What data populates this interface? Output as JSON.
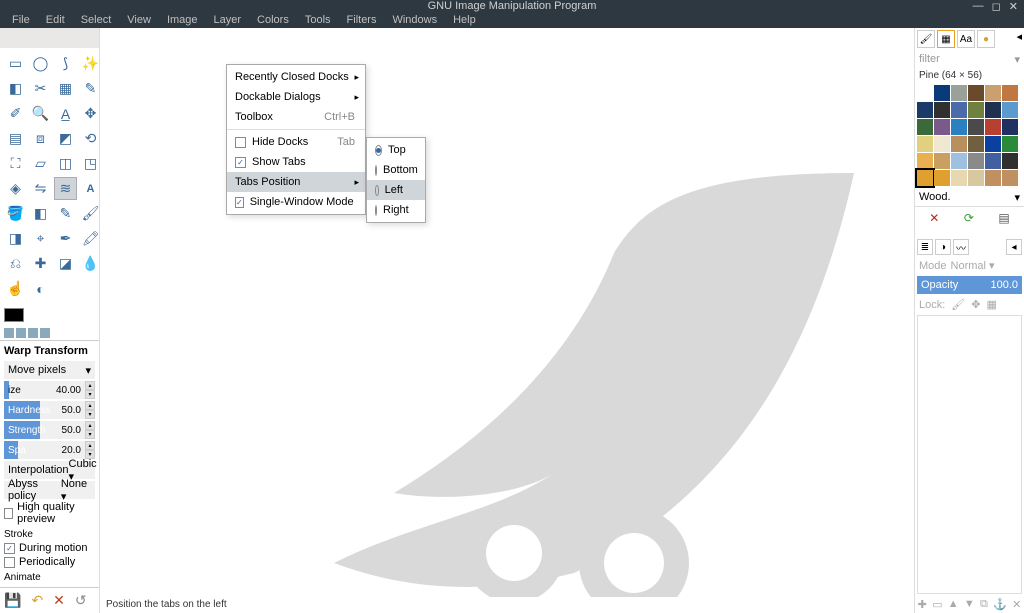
{
  "title": "GNU Image Manipulation Program",
  "menubar": [
    "File",
    "Edit",
    "Select",
    "View",
    "Image",
    "Layer",
    "Colors",
    "Tools",
    "Filters",
    "Windows",
    "Help"
  ],
  "windows_menu": {
    "recent": "Recently Closed Docks",
    "dockable": "Dockable Dialogs",
    "toolbox": "Toolbox",
    "toolbox_accel": "Ctrl+B",
    "hide_docks": "Hide Docks",
    "hide_docks_accel": "Tab",
    "show_tabs": "Show Tabs",
    "tabs_position": "Tabs Position",
    "single_window": "Single-Window Mode"
  },
  "tabs_menu": {
    "top": "Top",
    "bottom": "Bottom",
    "left": "Left",
    "right": "Right"
  },
  "status": "Position the tabs on the left",
  "tool_options": {
    "title": "Warp Transform",
    "mode": "Move pixels",
    "size_label": "ize",
    "size_val": "40.00",
    "hardness_label": "Hardness",
    "hardness_val": "50.0",
    "strength_label": "Strength",
    "strength_val": "50.0",
    "spacing_label": "Spa",
    "spacing_val": "20.0",
    "interp_label": "Interpolation",
    "interp_val": "Cubic",
    "abyss_label": "Abyss policy",
    "abyss_val": "None",
    "hq": "High quality preview",
    "stroke": "Stroke",
    "during": "During motion",
    "periodic": "Periodically",
    "animate": "Animate"
  },
  "right": {
    "filter": "filter",
    "pattern_label": "Pine (64 × 56)",
    "selected_name": "Wood.",
    "mode": "Mode",
    "mode_val": "Normal",
    "opacity": "Opacity",
    "opacity_val": "100.0",
    "lock": "Lock:"
  },
  "pattern_colors": [
    "#fff",
    "#0a3a7a",
    "#9aa09a",
    "#6a4a2a",
    "#caa070",
    "#c07840",
    "#1a3a6a",
    "#303030",
    "#4a6aaa",
    "#708040",
    "#203050",
    "#5a9acf",
    "#3a6a3a",
    "#7a5a8a",
    "#2a80c0",
    "#4a4a4a",
    "#b84030",
    "#203060",
    "#e0d080",
    "#f0e8d0",
    "#b89060",
    "#706040",
    "#0a40a0",
    "#2a8a3a",
    "#e8b050",
    "#caa060",
    "#a0c0e0",
    "#8a8a8a",
    "#4060a0",
    "#303030",
    "#e0a030",
    "#e0a030",
    "#e8d8b0",
    "#d8c8a0",
    "#c09060",
    "#c09060"
  ]
}
